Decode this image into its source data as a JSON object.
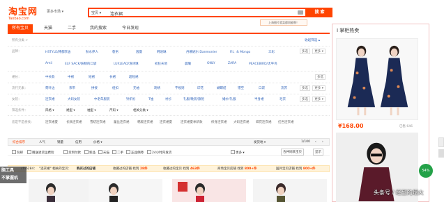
{
  "header": {
    "logo_cn": "淘宝网",
    "logo_en": "Taobao.com",
    "region": "更多市场 ▾",
    "search_scope": "宝贝 ▾",
    "search_value": "连衣裙",
    "search_button": "搜 索",
    "promo": "上海图片就卖都同能啊！"
  },
  "nav": {
    "tabs": [
      "所有宝贝",
      "天猫",
      "二手",
      "我的搜索",
      "今日发现"
    ]
  },
  "filter": {
    "collapse": "收起筛选 ▴",
    "rows": [
      {
        "label": "所有分类 >",
        "values": [],
        "opts": []
      },
      {
        "label": "品牌：",
        "values": [
          "HSTYLE/韩都衣舍",
          "秋水伊人",
          "裂帛",
          "茵曼",
          "韩语琳",
          "丹慕妮尔 Danmonier",
          "Fil、& Mongo",
          "三彩"
        ],
        "opts": [
          "多选",
          "更多 ▾"
        ]
      },
      {
        "label": "",
        "values": [
          "Amii",
          "ELF SACK/妖精的口袋",
          "LUXLEAD/洛诗琳",
          "初狂天地",
          "晨曦",
          "ONLY",
          "ZARA",
          "PEACEBIRD/太平鸟"
        ],
        "opts": []
      },
      {
        "label": "裙长：",
        "values": [
          "中长款",
          "中裙",
          "短裙",
          "长裙",
          "超短裙"
        ],
        "opts": [
          "多选"
        ]
      },
      {
        "label": "流行元素：",
        "values": [
          "荷叶边",
          "系带",
          "拼接",
          "纽扣",
          "无袖",
          "刺绣",
          "不规则",
          "印花",
          "蝴蝶结",
          "镂空",
          "口袋",
          "流苏"
        ],
        "opts": [
          "多选",
          "更多 ▾"
        ]
      },
      {
        "label": "女装：",
        "values": [
          "连衣裙",
          "大码女装",
          "中老年服装",
          "针织衫",
          "T恤",
          "衬衫",
          "礼服/晚装/旗袍",
          "婚纱/礼服",
          "半身裙",
          "毛衣"
        ],
        "opts": [
          "多选",
          "更多 ▾"
        ]
      },
      {
        "label": "筛选条件：",
        "values": [],
        "opts": []
      },
      {
        "label": "您是不是想找：",
        "values": [
          "连衣裙夏",
          "长款连衣裙",
          "雪纺连衣裙",
          "蕾丝连衣裙",
          "韩版连衣裙",
          "连衣裙夏",
          "连衣裙夏季新款",
          "修身连衣裙",
          "大码连衣裙",
          "碎花连衣裙",
          "红色连衣裙"
        ],
        "opts": []
      }
    ],
    "dropdowns": [
      "风格 ▾",
      "裙型 ▾",
      "袖型 ▾",
      "尺码 ▾",
      "相关分类 ▾"
    ]
  },
  "sortbar": {
    "items": [
      "综合排序",
      "人气",
      "销量",
      "信用",
      "价格 ▾"
    ],
    "right": [
      "发货地 ▾",
      "1/100",
      "‹",
      "›"
    ]
  },
  "checkbar": {
    "items": [
      "包邮",
      "赠送退货运费险",
      "货到付款",
      "新品",
      "天猫",
      "二手",
      "正品保障",
      "24小时内发货"
    ],
    "more": "更多 ▾",
    "buttons": [
      "合并同款宝贝",
      "显示"
    ]
  },
  "ybar": {
    "items": [
      {
        "text": "cfn6284：",
        "num": ""
      },
      {
        "text": "\"连衣裙\" 相关的宝贝：",
        "num": ""
      },
      {
        "text": "购买过的店铺",
        "num": ""
      },
      {
        "text": "收藏过的店铺 找到",
        "num": "28件"
      },
      {
        "text": "收藏过的宝贝 找到",
        "num": "463件"
      },
      {
        "text": "商场宝贝店铺 找到",
        "num": "800+件"
      },
      {
        "text": "国外宝贝店铺 找到",
        "num": "800+件"
      }
    ]
  },
  "watermark": {
    "line1": "脑工具",
    "line2": "不掌握机"
  },
  "right_panel": {
    "title": "I 掌柜热卖",
    "price": "¥168.00",
    "sold": "已售 646"
  },
  "badge": "54%",
  "footer_watermark": "头条号 / 经型的烟火"
}
